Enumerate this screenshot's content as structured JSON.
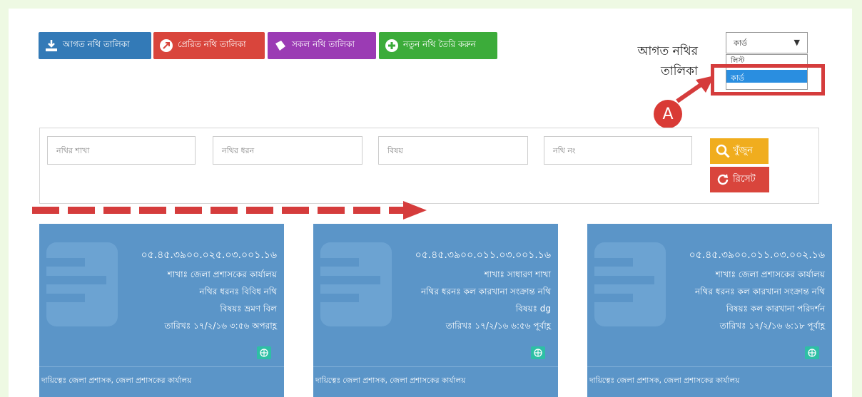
{
  "toolbar": {
    "incoming_label": "আগত নথি তালিকা",
    "sent_label": "প্রেরিত নথি তালিকা",
    "all_label": "সকল নথি তালিকা",
    "new_label": "নতুন নথি তৈরি করুন"
  },
  "list_title": "আগত নথির তালিকা",
  "view_select": {
    "selected": "কার্ড",
    "options": [
      "লিস্ট",
      "কার্ড"
    ]
  },
  "annotation": {
    "marker": "A"
  },
  "filters": {
    "branch_placeholder": "নথির শাখা",
    "type_placeholder": "নথির ধরন",
    "subject_placeholder": "বিষয়",
    "number_placeholder": "নথি নং",
    "search_label": "খুঁজুন",
    "reset_label": "রিসেট"
  },
  "cards": [
    {
      "number": "০৫.৪৫.৩৯০০.০২৫.০৩.০০১.১৬",
      "branch": "শাখাঃ জেলা প্রশাসকের কার্যালয়",
      "type": "নথির ধরনঃ বিবিধ নথি",
      "subject": "বিষয়ঃ ভ্রমণ বিল",
      "date": "তারিখঃ ১৭/২/১৬ ৩:৫৬ অপরাহ্ণ",
      "footer": "দায়িত্বেঃ জেলা প্রশাসক, জেলা প্রশাসকের কার্যালয়"
    },
    {
      "number": "০৫.৪৫.৩৯০০.০১১.০৩.০০১.১৬",
      "branch": "শাখাঃ সাধারণ শাখা",
      "type": "নথির ধরনঃ কল কারখানা সংক্রান্ত নথি",
      "subject": "বিষয়ঃ dg",
      "date": "তারিখঃ ১৭/২/১৬ ৬:৫৬ পূর্বাহ্ণ",
      "footer": "দায়িত্বেঃ জেলা প্রশাসক, জেলা প্রশাসকের কার্যালয়"
    },
    {
      "number": "০৫.৪৫.৩৯০০.০১১.০৩.০০২.১৬",
      "branch": "শাখাঃ জেলা প্রশাসকের কার্যালয়",
      "type": "নথির ধরনঃ কল কারখানা সংক্রান্ত নথি",
      "subject": "বিষয়ঃ কল কারখানা পরিদর্শন",
      "date": "তারিখঃ ১৭/২/১৬ ৬:১৮ পূর্বাহ্ণ",
      "footer": "দায়িত্বেঃ জেলা প্রশাসক, জেলা প্রশাসকের কার্যালয়"
    }
  ],
  "colors": {
    "background": "#eef9e3",
    "btn_blue": "#337ab7",
    "btn_red": "#d9453c",
    "btn_purple": "#9b3bb4",
    "btn_green": "#3cac3a",
    "btn_orange": "#f0ad1e",
    "card_blue": "#5b95c8",
    "annotation_red": "#d53c3c"
  },
  "icons": [
    "download-icon",
    "send-icon",
    "folder-icon",
    "plus-circle-icon",
    "search-icon",
    "refresh-icon",
    "globe-icon",
    "document-icon",
    "arrow-icon"
  ]
}
